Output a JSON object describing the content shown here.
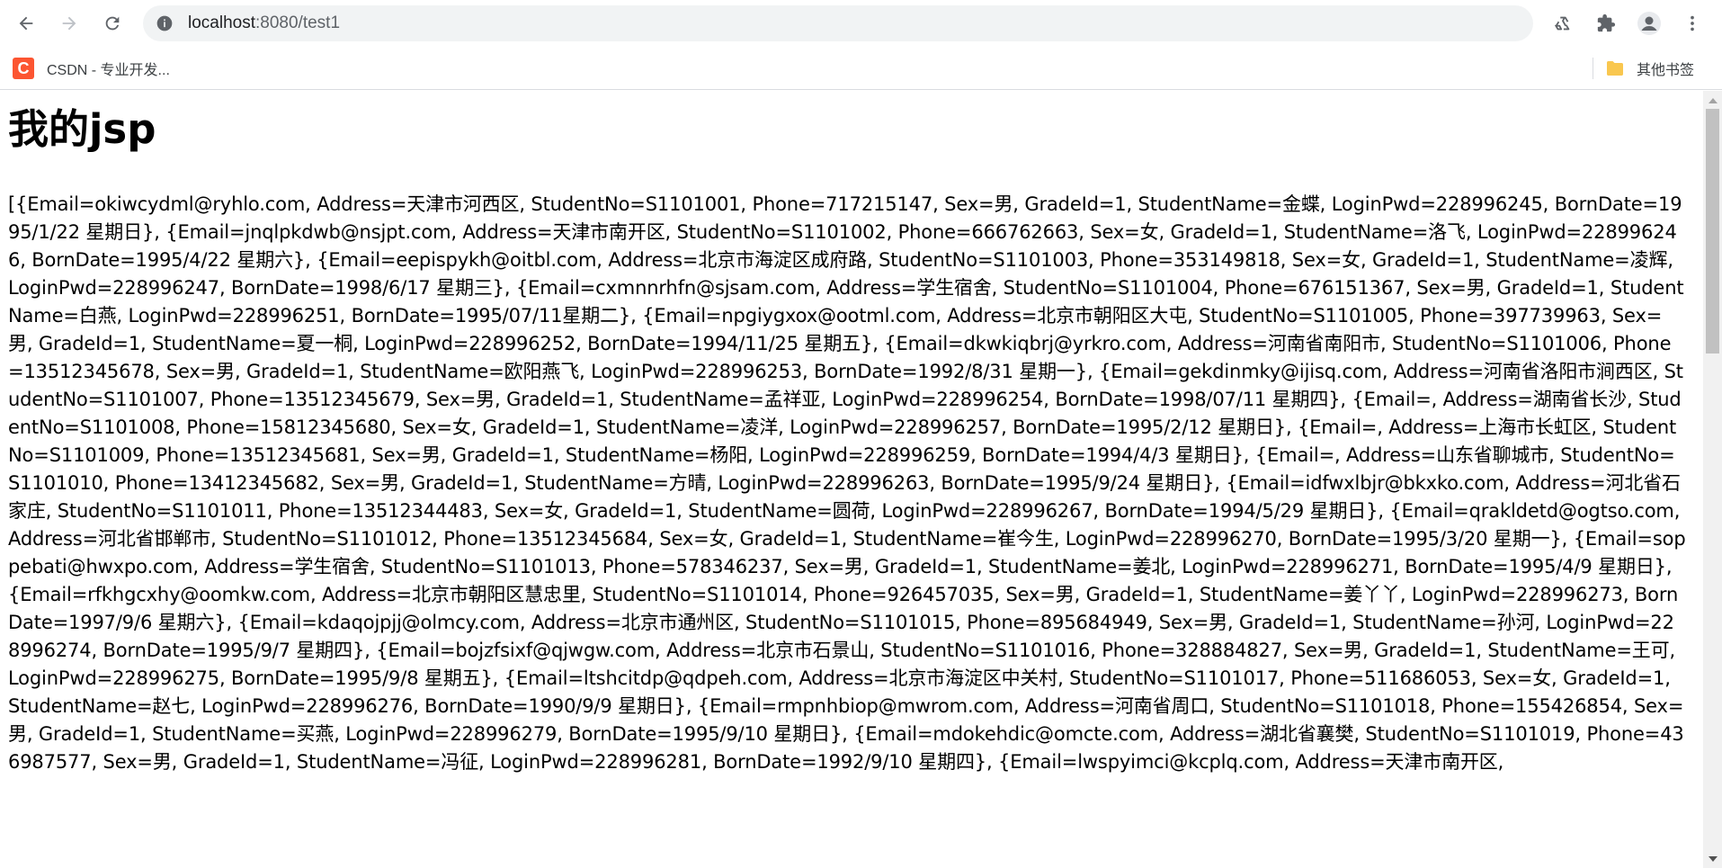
{
  "browser": {
    "url_host": "localhost",
    "url_rest": ":8080/test1",
    "icons": {
      "back": "arrow-left-icon",
      "forward": "arrow-right-icon",
      "reload": "reload-icon",
      "site_info": "site-info-icon",
      "recycle": "recycle-icon",
      "extensions": "puzzle-icon",
      "profile": "profile-icon",
      "menu": "kebab-menu-icon"
    }
  },
  "bookmarks": {
    "items": [
      {
        "label": "CSDN - 专业开发...",
        "icon_letter": "C",
        "icon_color": "#fc5531"
      }
    ],
    "other_label": "其他书签",
    "folder_color": "#f9c74f"
  },
  "page": {
    "title": "我的jsp",
    "body_text": "[{Email=okiwcydml@ryhlo.com, Address=天津市河西区, StudentNo=S1101001, Phone=717215147, Sex=男, GradeId=1, StudentName=金蝶, LoginPwd=228996245, BornDate=1995/1/22 星期日}, {Email=jnqlpkdwb@nsjpt.com, Address=天津市南开区, StudentNo=S1101002, Phone=666762663, Sex=女, GradeId=1, StudentName=洛飞, LoginPwd=228996246, BornDate=1995/4/22 星期六}, {Email=eepispykh@oitbl.com, Address=北京市海淀区成府路, StudentNo=S1101003, Phone=353149818, Sex=女, GradeId=1, StudentName=凌辉, LoginPwd=228996247, BornDate=1998/6/17 星期三}, {Email=cxmnnrhfn@sjsam.com, Address=学生宿舍, StudentNo=S1101004, Phone=676151367, Sex=男, GradeId=1, StudentName=白燕, LoginPwd=228996251, BornDate=1995/07/11星期二}, {Email=npgiygxox@ootml.com, Address=北京市朝阳区大屯, StudentNo=S1101005, Phone=397739963, Sex=男, GradeId=1, StudentName=夏一桐, LoginPwd=228996252, BornDate=1994/11/25 星期五}, {Email=dkwkiqbrj@yrkro.com, Address=河南省南阳市, StudentNo=S1101006, Phone=13512345678, Sex=男, GradeId=1, StudentName=欧阳燕飞, LoginPwd=228996253, BornDate=1992/8/31 星期一}, {Email=gekdinmky@ijisq.com, Address=河南省洛阳市涧西区, StudentNo=S1101007, Phone=13512345679, Sex=男, GradeId=1, StudentName=孟祥亚, LoginPwd=228996254, BornDate=1998/07/11 星期四}, {Email=, Address=湖南省长沙, StudentNo=S1101008, Phone=15812345680, Sex=女, GradeId=1, StudentName=凌洋, LoginPwd=228996257, BornDate=1995/2/12 星期日}, {Email=, Address=上海市长虹区, StudentNo=S1101009, Phone=13512345681, Sex=男, GradeId=1, StudentName=杨阳, LoginPwd=228996259, BornDate=1994/4/3 星期日}, {Email=, Address=山东省聊城市, StudentNo=S1101010, Phone=13412345682, Sex=男, GradeId=1, StudentName=方晴, LoginPwd=228996263, BornDate=1995/9/24 星期日}, {Email=idfwxlbjr@bkxko.com, Address=河北省石家庄, StudentNo=S1101011, Phone=13512344483, Sex=女, GradeId=1, StudentName=圆荷, LoginPwd=228996267, BornDate=1994/5/29 星期日}, {Email=qrakldetd@ogtso.com, Address=河北省邯郸市, StudentNo=S1101012, Phone=13512345684, Sex=女, GradeId=1, StudentName=崔今生, LoginPwd=228996270, BornDate=1995/3/20 星期一}, {Email=soppebati@hwxpo.com, Address=学生宿舍, StudentNo=S1101013, Phone=578346237, Sex=男, GradeId=1, StudentName=姜北, LoginPwd=228996271, BornDate=1995/4/9 星期日}, {Email=rfkhgcxhy@oomkw.com, Address=北京市朝阳区慧忠里, StudentNo=S1101014, Phone=926457035, Sex=男, GradeId=1, StudentName=姜丫丫, LoginPwd=228996273, BornDate=1997/9/6 星期六}, {Email=kdaqojpjj@olmcy.com, Address=北京市通州区, StudentNo=S1101015, Phone=895684949, Sex=男, GradeId=1, StudentName=孙河, LoginPwd=228996274, BornDate=1995/9/7 星期四}, {Email=bojzfsixf@qjwgw.com, Address=北京市石景山, StudentNo=S1101016, Phone=328884827, Sex=男, GradeId=1, StudentName=王可, LoginPwd=228996275, BornDate=1995/9/8 星期五}, {Email=ltshcitdp@qdpeh.com, Address=北京市海淀区中关村, StudentNo=S1101017, Phone=511686053, Sex=女, GradeId=1, StudentName=赵七, LoginPwd=228996276, BornDate=1990/9/9 星期日}, {Email=rmpnhbiop@mwrom.com, Address=河南省周口, StudentNo=S1101018, Phone=155426854, Sex=男, GradeId=1, StudentName=买燕, LoginPwd=228996279, BornDate=1995/9/10 星期日}, {Email=mdokehdic@omcte.com, Address=湖北省襄樊, StudentNo=S1101019, Phone=436987577, Sex=男, GradeId=1, StudentName=冯征, LoginPwd=228996281, BornDate=1992/9/10 星期四}, {Email=lwspyimci@kcplq.com, Address=天津市南开区,"
  }
}
